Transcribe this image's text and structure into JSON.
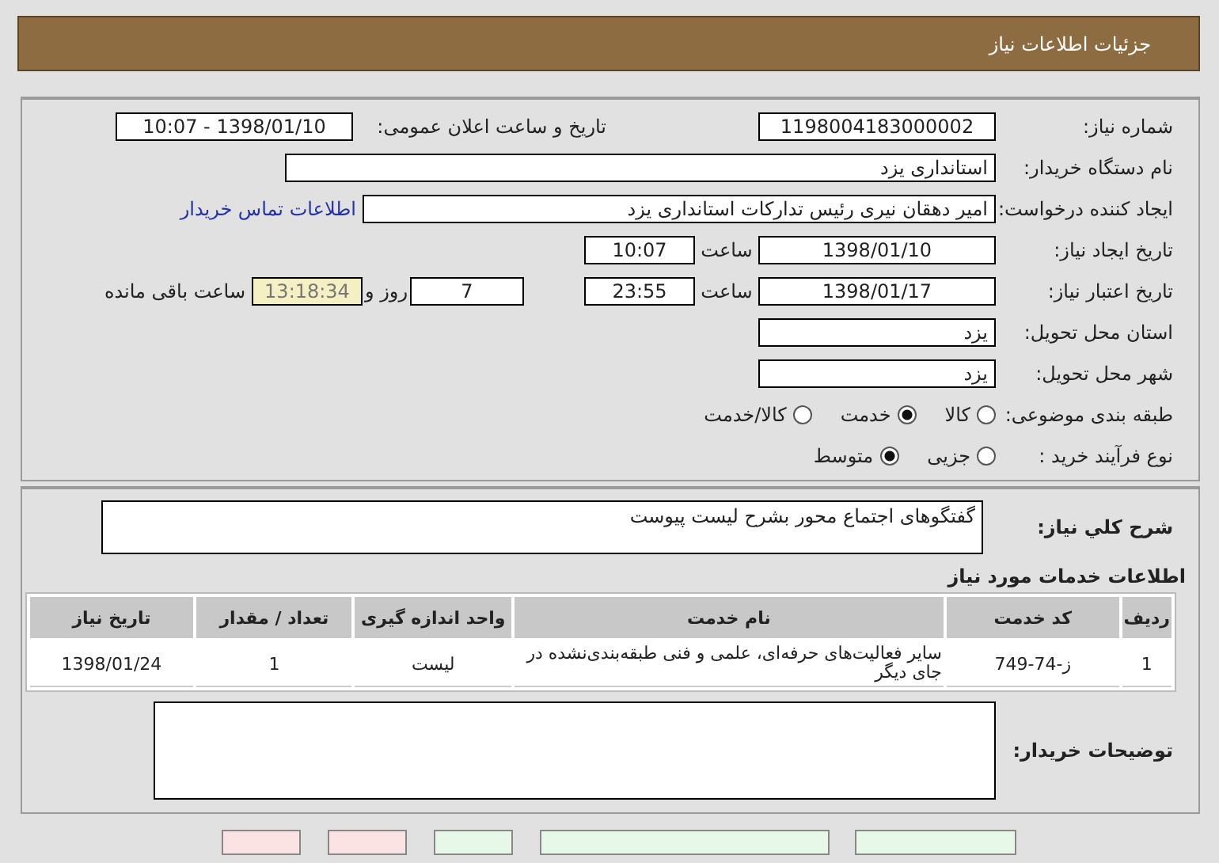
{
  "header": {
    "title": "جزئیات اطلاعات نیاز"
  },
  "details": {
    "need_number": {
      "label": "شماره نیاز:",
      "value": "1198004183000002"
    },
    "announce": {
      "label": "تاریخ و ساعت اعلان عمومی:",
      "value": "1398/01/10 - 10:07"
    },
    "buyer_org": {
      "label": "نام دستگاه خریدار:",
      "value": "استانداری یزد"
    },
    "requester": {
      "label": "ایجاد کننده درخواست:",
      "value": "امیر دهقان نیری رئیس تدارکات استانداری یزد"
    },
    "contact_link": "اطلاعات تماس خریدار",
    "created": {
      "label": "تاریخ ایجاد نیاز:",
      "date": "1398/01/10",
      "time_label": "ساعت",
      "time": "10:07"
    },
    "validity": {
      "label": "تاریخ اعتبار نیاز:",
      "date": "1398/01/17",
      "time_label": "ساعت",
      "time": "23:55",
      "days": "7",
      "days_label": "روز و",
      "remaining": "13:18:34",
      "remaining_label": "ساعت باقی مانده"
    },
    "province": {
      "label": "استان محل تحویل:",
      "value": "یزد"
    },
    "city": {
      "label": "شهر محل تحویل:",
      "value": "یزد"
    },
    "category": {
      "label": "طبقه بندی موضوعی:",
      "options": [
        {
          "label": "کالا",
          "selected": false
        },
        {
          "label": "خدمت",
          "selected": true
        },
        {
          "label": "کالا/خدمت",
          "selected": false
        }
      ]
    },
    "process": {
      "label": "نوع فرآیند خرید :",
      "options": [
        {
          "label": "جزیی",
          "selected": false
        },
        {
          "label": "متوسط",
          "selected": true
        }
      ]
    }
  },
  "summary": {
    "label": "شرح کلي نياز:",
    "value": "گفتگوهای اجتماع محور بشرح لیست پیوست"
  },
  "services": {
    "title": "اطلاعات خدمات مورد نیاز",
    "columns": [
      "ردیف",
      "کد خدمت",
      "نام خدمت",
      "واحد اندازه گیری",
      "تعداد / مقدار",
      "تاریخ نیاز"
    ],
    "rows": [
      [
        "1",
        "ز-74-749",
        "سایر فعالیت‌های حرفه‌ای، علمی و فنی طبقه‌بندی‌نشده در جای دیگر",
        "لیست",
        "1",
        "1398/01/24"
      ]
    ]
  },
  "buyer_notes": {
    "label": "توضیحات خریدار:"
  },
  "bottom_buttons": [
    {
      "color": "#e8f8e8"
    },
    {
      "color": "#e8f8e8"
    },
    {
      "color": "#e8f8e8"
    },
    {
      "color": "#fbe3e3"
    },
    {
      "color": "#fbe3e3"
    }
  ]
}
